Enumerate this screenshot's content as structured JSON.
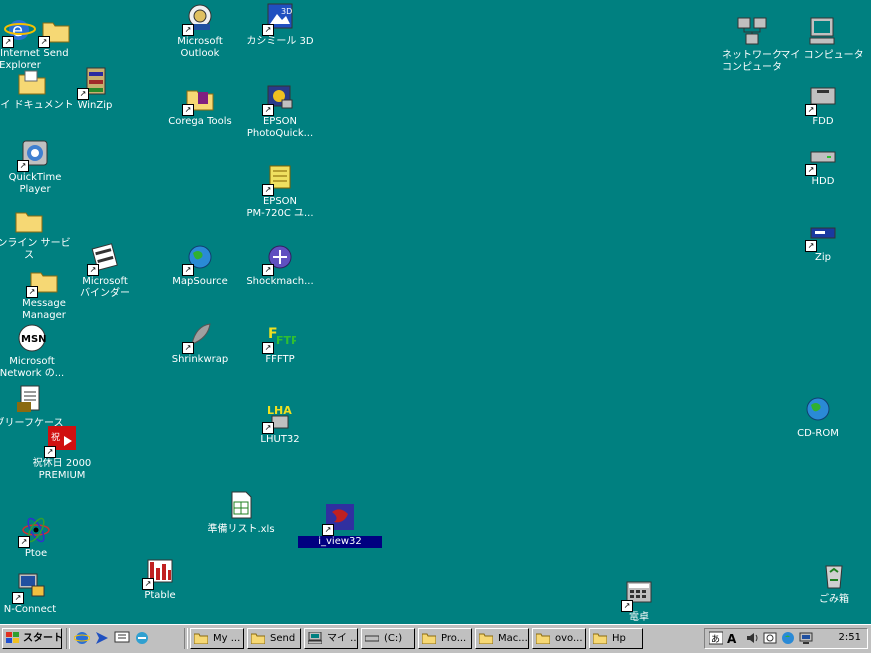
{
  "colors": {
    "desktop": "#008080",
    "taskbar": "#c0c0c0",
    "selection": "#000080"
  },
  "desktop": {
    "icons": [
      {
        "id": "ie",
        "label": "Internet\nExplorer",
        "icon": "ie-icon"
      },
      {
        "id": "send",
        "label": "Send",
        "icon": "folder-icon"
      },
      {
        "id": "mydocs",
        "label": "マイ ドキュメント",
        "icon": "folder-icon"
      },
      {
        "id": "winzip",
        "label": "WinZip",
        "icon": "winzip-icon"
      },
      {
        "id": "quicktime",
        "label": "QuickTime\nPlayer",
        "icon": "quicktime-icon"
      },
      {
        "id": "online",
        "label": "オンライン サービス",
        "icon": "folder-icon"
      },
      {
        "id": "msgmgr",
        "label": "Message\nManager",
        "icon": "folder-icon"
      },
      {
        "id": "binder",
        "label": "Microsoft\nバインダー",
        "icon": "binder-icon"
      },
      {
        "id": "msn",
        "label": "Microsoft\nNetwork の...",
        "icon": "msn-icon"
      },
      {
        "id": "briefcase",
        "label": "ブリーフケース",
        "icon": "briefcase-icon"
      },
      {
        "id": "kyujitsu",
        "label": "祝休日 2000\nPREMIUM",
        "icon": "calendar-app-icon"
      },
      {
        "id": "ptoe",
        "label": "Ptoe",
        "icon": "atom-icon"
      },
      {
        "id": "nconnect",
        "label": "N-Connect",
        "icon": "network-pc-icon"
      },
      {
        "id": "outlook",
        "label": "Microsoft\nOutlook",
        "icon": "outlook-icon"
      },
      {
        "id": "corega",
        "label": "Corega Tools",
        "icon": "corega-icon"
      },
      {
        "id": "mapsource",
        "label": "MapSource",
        "icon": "globe-icon"
      },
      {
        "id": "shrinkwrap",
        "label": "Shrinkwrap",
        "icon": "shrinkwrap-icon"
      },
      {
        "id": "ptable",
        "label": "Ptable",
        "icon": "ptable-icon"
      },
      {
        "id": "kasimir",
        "label": "カシミール 3D",
        "icon": "kasimir-icon"
      },
      {
        "id": "epsonquick",
        "label": "EPSON\nPhotoQuick...",
        "icon": "epson-photo-icon"
      },
      {
        "id": "epsonpm",
        "label": "EPSON\nPM-720C ユ...",
        "icon": "epson-printer-icon"
      },
      {
        "id": "shockmach",
        "label": "Shockmach...",
        "icon": "shockmachine-icon"
      },
      {
        "id": "ffftp",
        "label": "FFFTP",
        "icon": "ffftp-icon"
      },
      {
        "id": "lhut32",
        "label": "LHUT32",
        "icon": "lhut-icon"
      },
      {
        "id": "junbi",
        "label": "準備リスト.xls",
        "icon": "excel-file-icon"
      },
      {
        "id": "iview",
        "label": "i_view32",
        "icon": "irfanview-icon"
      },
      {
        "id": "network",
        "label": "ネットワーク\nコンピュータ",
        "icon": "network-neighborhood-icon"
      },
      {
        "id": "mycomputer",
        "label": "マイ コンピュータ",
        "icon": "computer-icon"
      },
      {
        "id": "fdd",
        "label": "FDD",
        "icon": "floppy-icon"
      },
      {
        "id": "hdd",
        "label": "HDD",
        "icon": "hard-drive-icon"
      },
      {
        "id": "zip",
        "label": "Zip",
        "icon": "zip-drive-icon"
      },
      {
        "id": "cdrom",
        "label": "CD-ROM",
        "icon": "cdrom-icon"
      },
      {
        "id": "dentaku",
        "label": "電卓",
        "icon": "calculator-icon"
      },
      {
        "id": "recycle",
        "label": "ごみ箱",
        "icon": "recycle-bin-icon"
      }
    ]
  },
  "taskbar": {
    "start_label": "スタート",
    "quick_launch": [
      "ie-icon",
      "outlook-express-icon",
      "desktop-icon",
      "channel-icon"
    ],
    "buttons": [
      {
        "label": "My ...",
        "icon": "folder-icon"
      },
      {
        "label": "Send",
        "icon": "folder-icon"
      },
      {
        "label": "マイ ...",
        "icon": "computer-icon"
      },
      {
        "label": "(C:)",
        "icon": "hard-drive-icon"
      },
      {
        "label": "Pro...",
        "icon": "folder-icon"
      },
      {
        "label": "Mac...",
        "icon": "folder-icon"
      },
      {
        "label": "ovo...",
        "icon": "folder-icon"
      },
      {
        "label": "Hp",
        "icon": "folder-icon"
      }
    ],
    "tray_icons": [
      "ime-icon",
      "accessibility-icon",
      "volume-icon",
      "task-scheduler-icon",
      "network-status-icon",
      "display-icon"
    ],
    "clock": "2:51"
  }
}
